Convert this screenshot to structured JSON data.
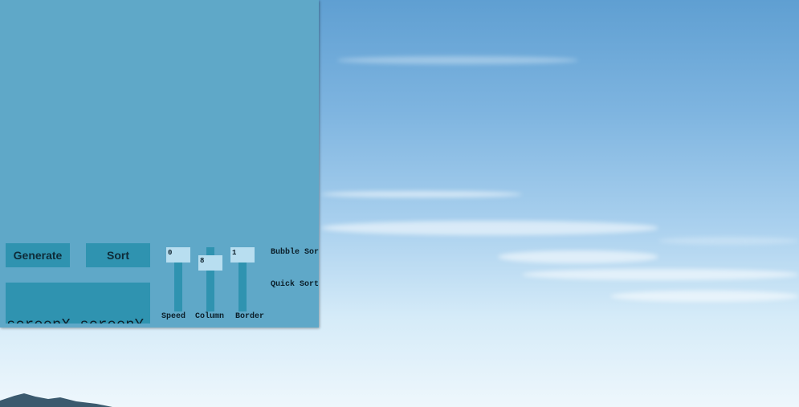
{
  "controls": {
    "generate_label": "Generate",
    "sort_label": "Sort"
  },
  "coordinates": {
    "header": "screenX,screenY",
    "open_paren": "(",
    "comma": ",",
    "close_paren": ")"
  },
  "sliders": [
    {
      "label": "Speed",
      "value": "0"
    },
    {
      "label": "Column",
      "value": "8"
    },
    {
      "label": "Border",
      "value": "1"
    }
  ],
  "algorithms": [
    {
      "label": "Bubble Sort"
    },
    {
      "label": "Quick Sort"
    }
  ]
}
